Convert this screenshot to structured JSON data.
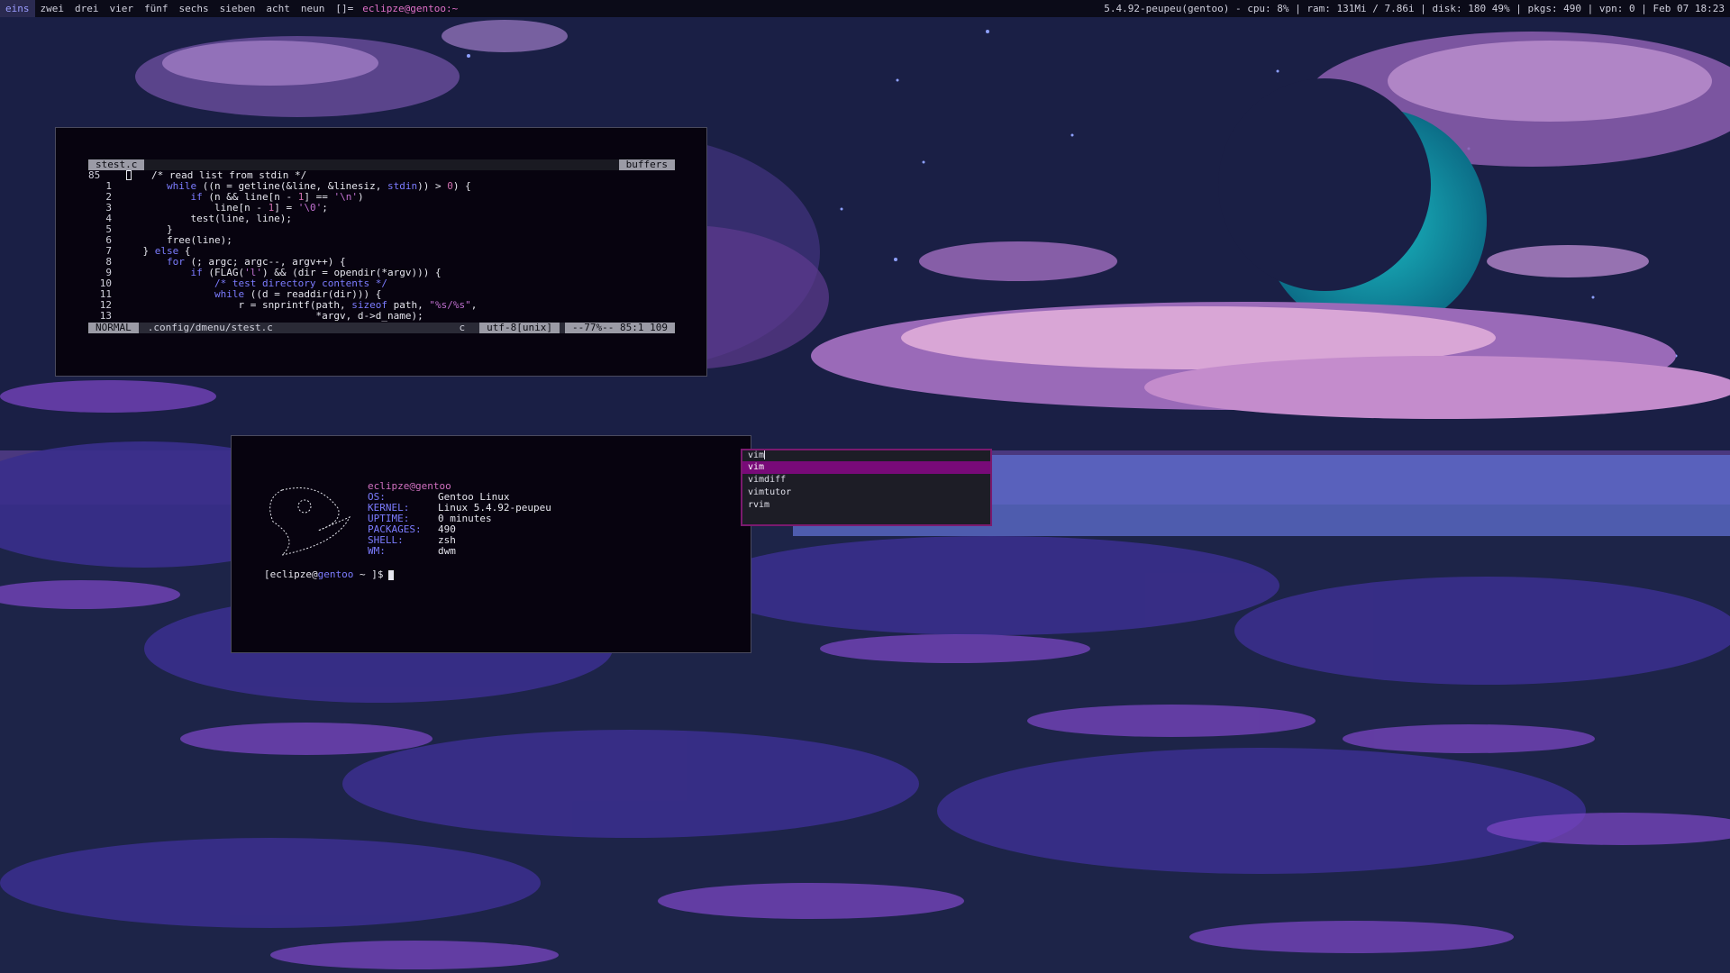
{
  "bar": {
    "workspaces": [
      "eins",
      "zwei",
      "drei",
      "vier",
      "fünf",
      "sechs",
      "sieben",
      "acht",
      "neun"
    ],
    "layout": "[]=",
    "window_title": "eclipze@gentoo:~",
    "status": "5.4.92-peupeu(gentoo) - cpu: 8% | ram: 131Mi / 7.86i | disk: 180 49% | pkgs: 490 | vpn: 0 | Feb 07 18:23",
    "active_color": "#9a9cff"
  },
  "vim": {
    "tab_label": "stest.c",
    "buffers_label": "buffers",
    "current_line": "85",
    "lines": [
      {
        "n": "1",
        "segs": [
          [
            "        ",
            ""
          ],
          [
            "while",
            ""
          ],
          [
            " ((n = getline(&line, &linesiz, ",
            ""
          ],
          [
            "stdin",
            ""
          ],
          [
            ")) > ",
            ""
          ],
          [
            "0",
            ""
          ],
          [
            ") {",
            ""
          ]
        ]
      },
      {
        "n": "2",
        "segs": [
          [
            "            ",
            ""
          ],
          [
            "if",
            ""
          ],
          [
            " (n && line[n - ",
            ""
          ],
          [
            "1",
            ""
          ],
          [
            "] == ",
            ""
          ],
          [
            "'\\n'",
            ""
          ],
          [
            ")",
            ""
          ]
        ]
      },
      {
        "n": "3",
        "segs": [
          [
            "                line[n - ",
            ""
          ],
          [
            "1",
            ""
          ],
          [
            "] = ",
            ""
          ],
          [
            "'\\0'",
            ""
          ],
          [
            ";",
            ""
          ]
        ]
      },
      {
        "n": "4",
        "segs": [
          [
            "            test(line, line);",
            ""
          ]
        ]
      },
      {
        "n": "5",
        "segs": [
          [
            "        }",
            ""
          ]
        ]
      },
      {
        "n": "6",
        "segs": [
          [
            "        free(line);",
            ""
          ]
        ]
      },
      {
        "n": "7",
        "segs": [
          [
            "    } ",
            ""
          ],
          [
            "else",
            ""
          ],
          [
            " {",
            ""
          ]
        ]
      },
      {
        "n": "8",
        "segs": [
          [
            "        ",
            ""
          ],
          [
            "for",
            ""
          ],
          [
            " (; argc; argc--, argv++) {",
            ""
          ]
        ]
      },
      {
        "n": "9",
        "segs": [
          [
            "            ",
            ""
          ],
          [
            "if",
            ""
          ],
          [
            " (FLAG(",
            ""
          ],
          [
            "'l'",
            ""
          ],
          [
            ") && (dir = opendir(*argv))) {",
            ""
          ]
        ]
      },
      {
        "n": "10",
        "segs": [
          [
            "                ",
            ""
          ],
          [
            "/* test directory contents */",
            ""
          ]
        ]
      },
      {
        "n": "11",
        "segs": [
          [
            "                ",
            ""
          ],
          [
            "while",
            ""
          ],
          [
            " ((d = readdir(dir))) {",
            ""
          ]
        ]
      },
      {
        "n": "12",
        "segs": [
          [
            "                    r = snprintf(path, ",
            ""
          ],
          [
            "sizeof",
            ""
          ],
          [
            " path, ",
            ""
          ],
          [
            "\"%s/%s\"",
            ""
          ],
          [
            ",",
            ""
          ]
        ]
      },
      {
        "n": "13",
        "segs": [
          [
            "                                 *argv, d->d_name);",
            ""
          ]
        ]
      }
    ],
    "first_line_comment": "/* read list from stdin */",
    "mode": "NORMAL",
    "filepath": ".config/dmenu/stest.c",
    "filetype": "c",
    "encoding": "utf-8[unix]",
    "position": "--77%-- 85:1 109"
  },
  "fetch": {
    "user": "eclipze",
    "at": "@",
    "host": "gentoo",
    "rows": [
      {
        "key": "OS:",
        "value": "Gentoo Linux"
      },
      {
        "key": "KERNEL:",
        "value": "Linux 5.4.92-peupeu"
      },
      {
        "key": "UPTIME:",
        "value": "0 minutes"
      },
      {
        "key": "PACKAGES:",
        "value": "490"
      },
      {
        "key": "SHELL:",
        "value": "zsh"
      },
      {
        "key": "WM:",
        "value": "dwm"
      }
    ],
    "prompt_open": "[eclipze@",
    "prompt_host": "gentoo",
    "prompt_close": " ~ ]$"
  },
  "dmenu": {
    "input": "vim",
    "items": [
      "vim",
      "vimdiff",
      "vimtutor",
      "rvim"
    ],
    "selected": 0,
    "border_color": "#7b1a6e",
    "selected_color": "#780a78"
  }
}
